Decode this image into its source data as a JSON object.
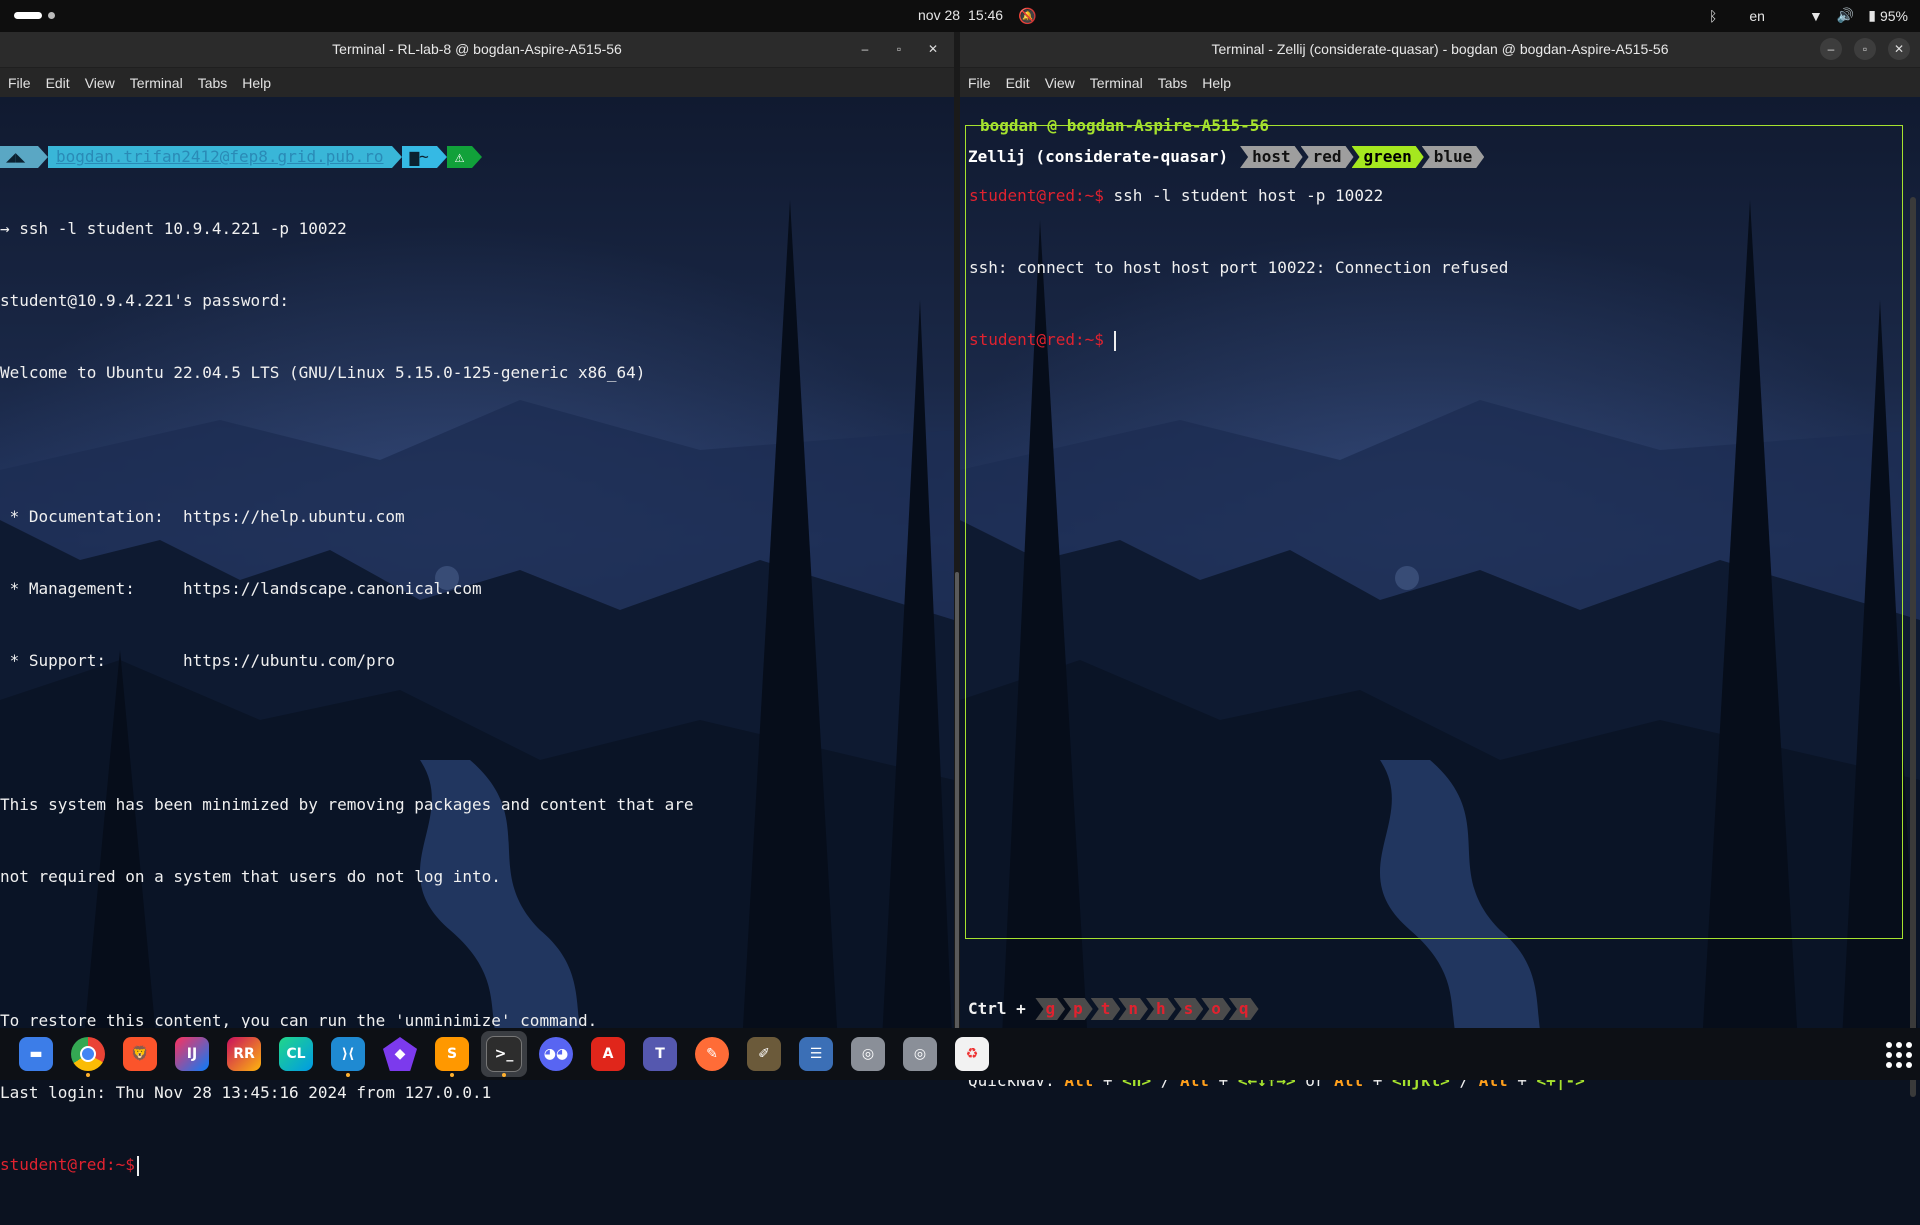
{
  "topbar": {
    "date": "nov 28",
    "time": "15:46",
    "language": "en",
    "battery": "95%"
  },
  "left_window": {
    "title": "Terminal - RL-lab-8 @ bogdan-Aspire-A515-56",
    "menu": [
      "File",
      "Edit",
      "View",
      "Terminal",
      "Tabs",
      "Help"
    ],
    "prompt_bar": {
      "host": "bogdan.trifan2412@fep8.grid.pub.ro",
      "dir": "~",
      "warn": "⚠"
    },
    "lines": [
      "→ ssh -l student 10.9.4.221 -p 10022",
      "student@10.9.4.221's password:",
      "Welcome to Ubuntu 22.04.5 LTS (GNU/Linux 5.15.0-125-generic x86_64)",
      "",
      " * Documentation:  https://help.ubuntu.com",
      " * Management:     https://landscape.canonical.com",
      " * Support:        https://ubuntu.com/pro",
      "",
      "This system has been minimized by removing packages and content that are",
      "not required on a system that users do not log into.",
      "",
      "To restore this content, you can run the 'unminimize' command.",
      "Last login: Thu Nov 28 13:45:16 2024 from 127.0.0.1"
    ],
    "prompt": "student@red:~$"
  },
  "right_window": {
    "title": "Terminal - Zellij (considerate-quasar) - bogdan @ bogdan-Aspire-A515-56",
    "menu": [
      "File",
      "Edit",
      "View",
      "Terminal",
      "Tabs",
      "Help"
    ],
    "session": "Zellij (considerate-quasar)",
    "tabs": [
      "host",
      "red",
      "green",
      "blue"
    ],
    "active_tab": "green",
    "pane_title": "bogdan @ bogdan-Aspire-A515-56",
    "prompt": "student@red:~$",
    "command": " ssh -l student host -p 10022",
    "output": "ssh: connect to host host port 10022: Connection refused",
    "ctrl_label": "Ctrl +",
    "ctrl_keys": [
      "g",
      "p",
      "t",
      "n",
      "h",
      "s",
      "o",
      "q"
    ],
    "quicknav": {
      "label": "QuickNav:",
      "alt": "Alt",
      "plus": "+",
      "slash": "/",
      "or": "or",
      "n": "<n>",
      "arrows": "<←↓↑→>",
      "hjkl": "<hjkl>",
      "plusminus": "<+|->"
    }
  },
  "dock": {
    "apps": [
      {
        "name": "files",
        "label": "",
        "color": "#3c7de8"
      },
      {
        "name": "chrome",
        "label": "",
        "color": "#dd4b39"
      },
      {
        "name": "brave",
        "label": "",
        "color": "#fb542b"
      },
      {
        "name": "intellij",
        "label": "IJ",
        "color": "#1a1a1a"
      },
      {
        "name": "rider",
        "label": "RR",
        "color": "#1a1a1a"
      },
      {
        "name": "clion",
        "label": "CL",
        "color": "#1a1a1a"
      },
      {
        "name": "vscode",
        "label": "",
        "color": "#1f8ad2"
      },
      {
        "name": "obsidian",
        "label": "",
        "color": "#7c3aed"
      },
      {
        "name": "sublime",
        "label": "",
        "color": "#ff9800"
      },
      {
        "name": "terminal",
        "label": ">_",
        "color": "#2d2d2d"
      },
      {
        "name": "discord",
        "label": "",
        "color": "#5865f2"
      },
      {
        "name": "acrobat",
        "label": "",
        "color": "#e0261b"
      },
      {
        "name": "teams",
        "label": "T",
        "color": "#5558af"
      },
      {
        "name": "postman",
        "label": "",
        "color": "#ff6c37"
      },
      {
        "name": "gimp",
        "label": "",
        "color": "#6b5a3a"
      },
      {
        "name": "settings-list",
        "label": "",
        "color": "#3b6fb6"
      },
      {
        "name": "disk-1",
        "label": "",
        "color": "#8a8f98"
      },
      {
        "name": "disk-2",
        "label": "",
        "color": "#8a8f98"
      },
      {
        "name": "trash",
        "label": "",
        "color": "#f2f2f2"
      }
    ]
  }
}
